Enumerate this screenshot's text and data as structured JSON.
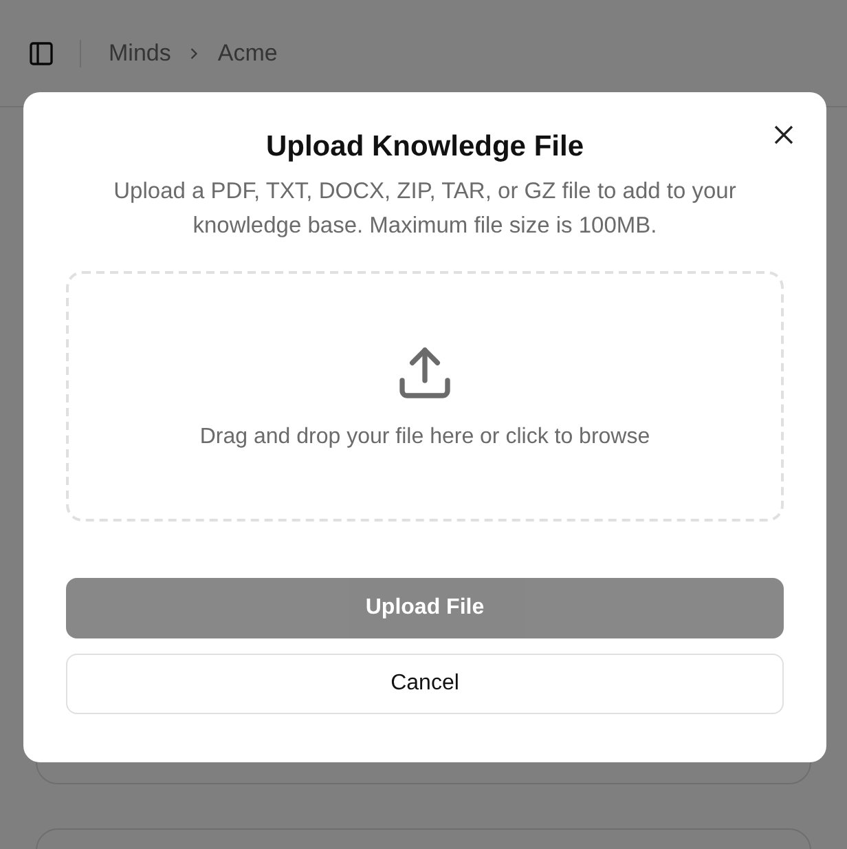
{
  "breadcrumb": [
    "Minds",
    "Acme"
  ],
  "dialog": {
    "title": "Upload Knowledge File",
    "description": "Upload a PDF, TXT, DOCX, ZIP, TAR, or GZ file to add to your knowledge base. Maximum file size is 100MB.",
    "dropzone_text": "Drag and drop your file here or click to browse",
    "buttons": [
      {
        "label": "Upload File",
        "kind": "primary",
        "disabled": true
      },
      {
        "label": "Cancel",
        "kind": "secondary",
        "disabled": false
      }
    ]
  }
}
